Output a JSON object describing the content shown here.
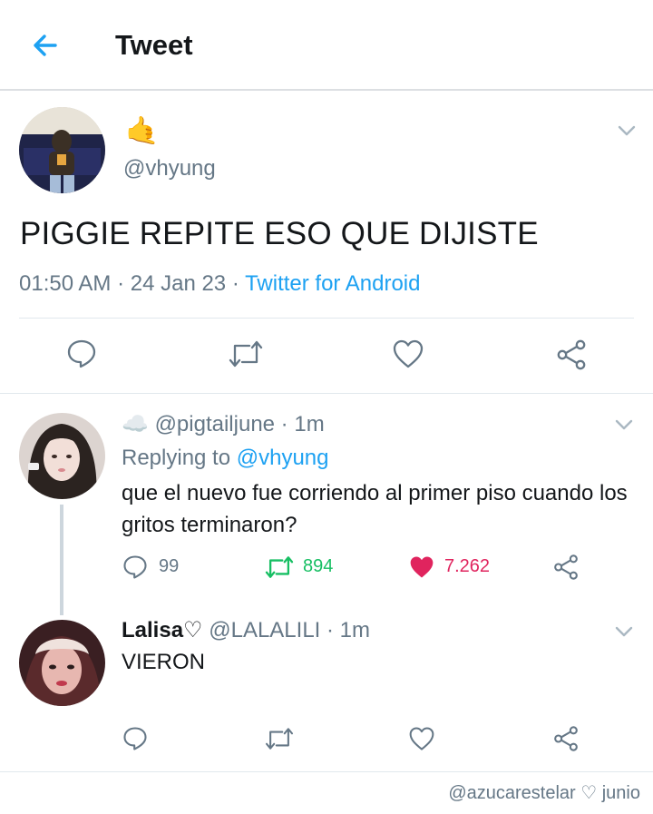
{
  "header": {
    "title": "Tweet"
  },
  "main_tweet": {
    "display_name": "🤙",
    "handle": "@vhyung",
    "text": "PIGGIE REPITE ESO QUE DIJISTE",
    "time": "01:50 AM",
    "date": "24 Jan 23",
    "source": "Twitter for Android",
    "separator": " · "
  },
  "reply1": {
    "name_emoji": "☁️",
    "handle": "@pigtailjune",
    "time": "1m",
    "replying_prefix": "Replying to ",
    "replying_handle": "@vhyung",
    "text_line1": "que el nuevo fue corriendo al primer piso cuando los",
    "text_line2": "gritos terminaron?",
    "replies": "99",
    "retweets": "894",
    "likes": "7.262"
  },
  "reply2": {
    "name": "Lalisa♡",
    "handle": "@LALALILI",
    "time": "1m",
    "text": "VIERON"
  },
  "watermark": "@azucarestelar ♡ junio",
  "colors": {
    "accent": "#1da1f2",
    "retweet": "#17bf63",
    "like": "#e0245e",
    "muted": "#657786"
  }
}
